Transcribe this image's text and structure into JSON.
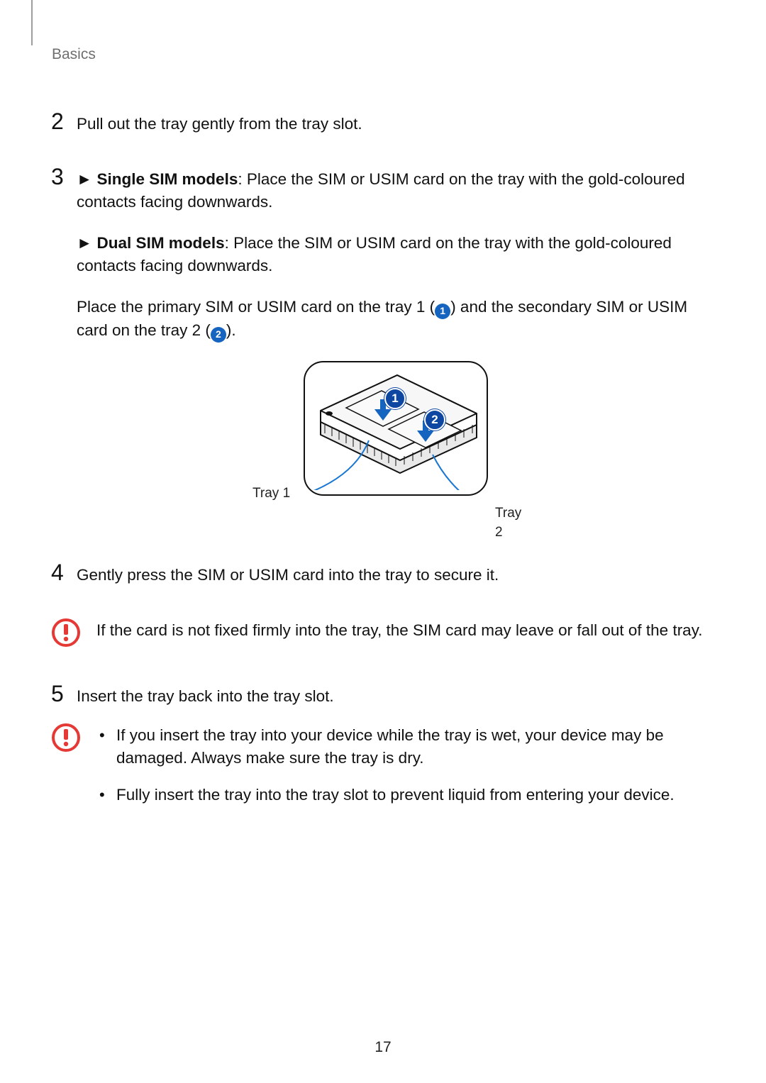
{
  "header": {
    "section": "Basics"
  },
  "steps": {
    "s2": {
      "num": "2",
      "text": "Pull out the tray gently from the tray slot."
    },
    "s3": {
      "num": "3",
      "single_bold": "Single SIM models",
      "single_text": ": Place the SIM or USIM card on the tray with the gold-coloured contacts facing downwards.",
      "dual_bold": "Dual SIM models",
      "dual_text": ": Place the SIM or USIM card on the tray with the gold-coloured contacts facing downwards.",
      "placement_a": "Place the primary SIM or USIM card on the tray 1 (",
      "placement_b": ") and the secondary SIM or USIM card on the tray 2 (",
      "placement_c": ").",
      "arrow": "►"
    },
    "s4": {
      "num": "4",
      "text": "Gently press the SIM or USIM card into the tray to secure it."
    },
    "s5": {
      "num": "5",
      "text": "Insert the tray back into the tray slot."
    }
  },
  "figure": {
    "marker1": "1",
    "marker2": "2",
    "tray1_label": "Tray 1",
    "tray2_label": "Tray 2"
  },
  "cautions": {
    "c1": {
      "text": "If the card is not fixed firmly into the tray, the SIM card may leave or fall out of the tray."
    },
    "c2": {
      "b1": "If you insert the tray into your device while the tray is wet, your device may be damaged. Always make sure the tray is dry.",
      "b2": "Fully insert the tray into the tray slot to prevent liquid from entering your device."
    }
  },
  "inline_markers": {
    "m1": "1",
    "m2": "2"
  },
  "page_number": "17",
  "colors": {
    "accent": "#1565c0",
    "caution": "#e53935"
  }
}
